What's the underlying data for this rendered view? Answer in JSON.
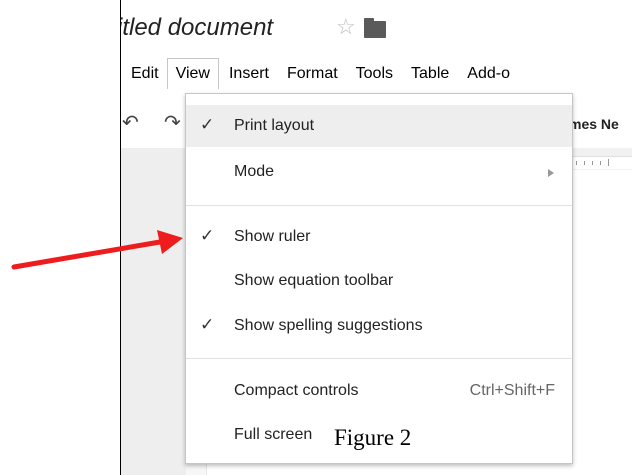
{
  "document": {
    "title": "itled document",
    "star_icon": "star-outline-icon",
    "folder_icon": "folder-icon"
  },
  "menubar": {
    "items": [
      {
        "label": "Edit"
      },
      {
        "label": "View",
        "active": true
      },
      {
        "label": "Insert"
      },
      {
        "label": "Format"
      },
      {
        "label": "Tools"
      },
      {
        "label": "Table"
      },
      {
        "label": "Add-o"
      }
    ]
  },
  "toolbar": {
    "undo_icon": "undo-icon",
    "redo_icon": "redo-icon",
    "font_name": "mes Ne"
  },
  "view_menu": {
    "items": [
      {
        "label": "Print layout",
        "checked": true,
        "highlighted": true
      },
      {
        "label": "Mode",
        "has_submenu": true
      },
      {
        "label": "Show ruler",
        "checked": true
      },
      {
        "label": "Show equation toolbar",
        "checked": false
      },
      {
        "label": "Show spelling suggestions",
        "checked": true
      },
      {
        "label": "Compact controls",
        "shortcut": "Ctrl+Shift+F"
      },
      {
        "label": "Full screen"
      }
    ]
  },
  "caption": "Figure 2",
  "colors": {
    "annotation_arrow": "#ee1c1c",
    "menu_highlight": "#eeeeee"
  }
}
